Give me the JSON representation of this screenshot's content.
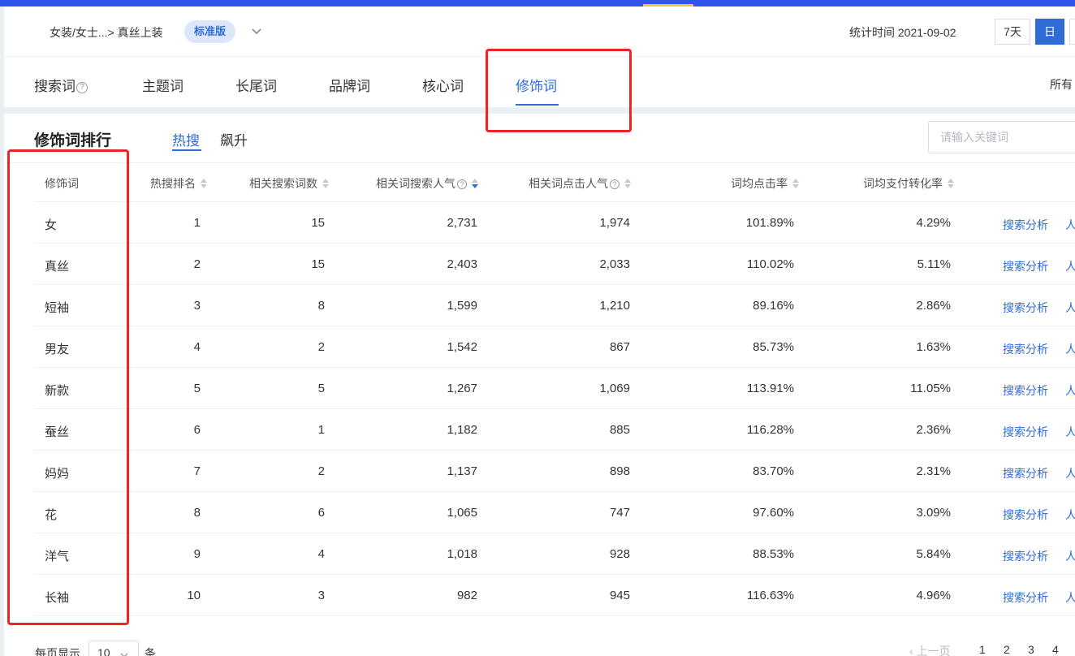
{
  "header": {
    "breadcrumb": "女装/女士...> 真丝上装",
    "edition": "标准版",
    "stat_time": "统计时间 2021-09-02",
    "range_7d": "7天",
    "range_day": "日"
  },
  "tabs": [
    {
      "label": "搜索词",
      "help": "?"
    },
    {
      "label": "主题词"
    },
    {
      "label": "长尾词"
    },
    {
      "label": "品牌词"
    },
    {
      "label": "核心词"
    },
    {
      "label": "修饰词",
      "active": true
    }
  ],
  "tabs_right": "所有",
  "section": {
    "title": "修饰词排行",
    "subtabs": [
      "热搜",
      "飙升"
    ],
    "search_placeholder": "请输入关键词"
  },
  "table": {
    "columns": [
      "修饰词",
      "热搜排名",
      "相关搜索词数",
      "相关词搜索人气",
      "相关词点击人气",
      "词均点击率",
      "词均支付转化率"
    ],
    "help_glyph": "?",
    "action_label": "搜索分析",
    "action2_label": "人",
    "rows": [
      [
        "女",
        "1",
        "15",
        "2,731",
        "1,974",
        "101.89%",
        "4.29%"
      ],
      [
        "真丝",
        "2",
        "15",
        "2,403",
        "2,033",
        "110.02%",
        "5.11%"
      ],
      [
        "短袖",
        "3",
        "8",
        "1,599",
        "1,210",
        "89.16%",
        "2.86%"
      ],
      [
        "男友",
        "4",
        "2",
        "1,542",
        "867",
        "85.73%",
        "1.63%"
      ],
      [
        "新款",
        "5",
        "5",
        "1,267",
        "1,069",
        "113.91%",
        "11.05%"
      ],
      [
        "蚕丝",
        "6",
        "1",
        "1,182",
        "885",
        "116.28%",
        "2.36%"
      ],
      [
        "妈妈",
        "7",
        "2",
        "1,137",
        "898",
        "83.70%",
        "2.31%"
      ],
      [
        "花",
        "8",
        "6",
        "1,065",
        "747",
        "97.60%",
        "3.09%"
      ],
      [
        "洋气",
        "9",
        "4",
        "1,018",
        "928",
        "88.53%",
        "5.84%"
      ],
      [
        "长袖",
        "10",
        "3",
        "982",
        "945",
        "116.63%",
        "4.96%"
      ]
    ]
  },
  "pagination": {
    "per_page_label": "每页显示",
    "per_page_value": "10",
    "unit": "条",
    "prev": "上一页",
    "pages": [
      "1",
      "2",
      "3",
      "4"
    ]
  },
  "colors": {
    "accent": "#2f6cd6",
    "annotation": "#ee2323",
    "topbar": "#2f54eb"
  }
}
